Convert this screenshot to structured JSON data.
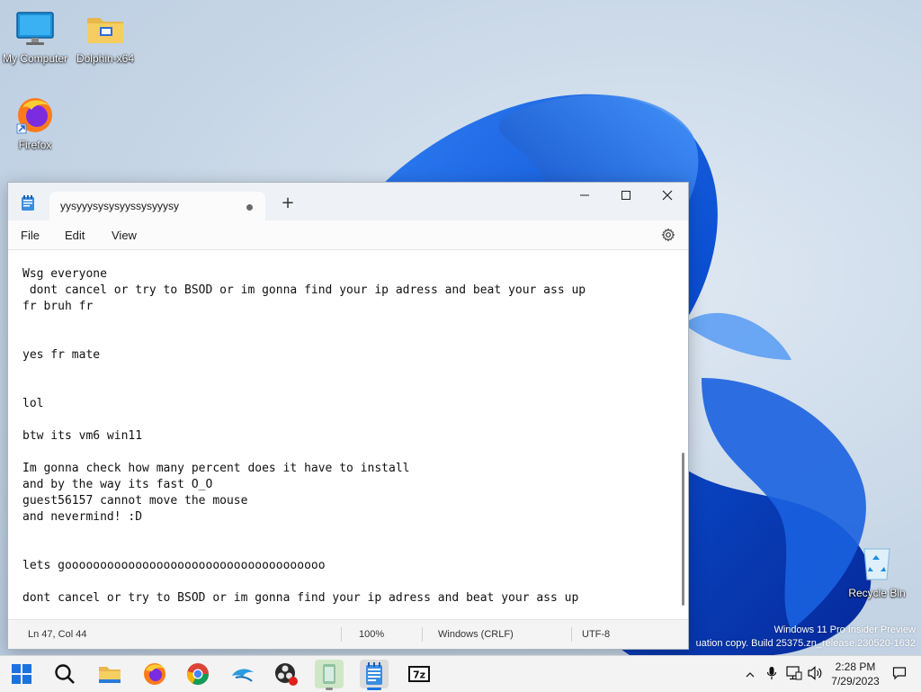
{
  "desktop": {
    "icons": [
      {
        "label": "My Computer"
      },
      {
        "label": "Dolphin-x64"
      },
      {
        "label": "Firefox"
      },
      {
        "label": "Recycle Bin"
      }
    ],
    "watermark_line1": "Windows 11 Pro Insider Preview",
    "watermark_line2": "uation copy. Build 25375.zn_release.230520-1632"
  },
  "notepad": {
    "tab_title": "yysyyysysysyyssysyyysy",
    "new_tab_symbol": "+",
    "menu": [
      "File",
      "Edit",
      "View"
    ],
    "lines": [
      "Wsg everyone",
      " dont cancel or try to BSOD or im gonna find your ip adress and beat your ass up",
      "fr bruh fr",
      "",
      "",
      "yes fr mate",
      "",
      "",
      "lol",
      "",
      "btw its vm6 win11",
      "",
      "Im gonna check how many percent does it have to install",
      "and by the way its fast O_O",
      "guest56157 cannot move the mouse",
      "and nevermind! :D",
      "",
      "",
      "lets gooooooooooooooooooooooooooooooooooooo",
      "",
      "dont cancel or try to BSOD or im gonna find your ip adress and beat your ass up"
    ],
    "status": {
      "position": "Ln 47, Col 44",
      "zoom": "100%",
      "line_ending": "Windows (CRLF)",
      "encoding": "UTF-8"
    }
  },
  "taskbar": {
    "apps": [
      "start-icon",
      "search-icon",
      "file-explorer-icon",
      "firefox-icon",
      "chrome-icon",
      "dolphin-icon",
      "obs-icon",
      "notepad-alt-icon",
      "notepad-icon",
      "7zip-icon"
    ],
    "time": "2:28 PM",
    "date": "7/29/2023"
  },
  "colors": {
    "accent": "#0a5bd6",
    "wallpaper": "#c7d6e6"
  }
}
